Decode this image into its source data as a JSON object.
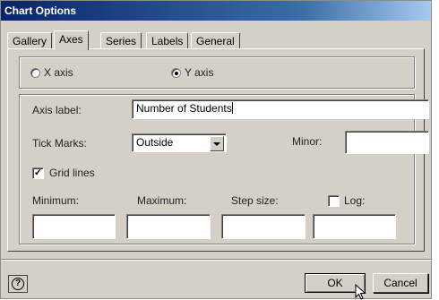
{
  "window": {
    "title": "Chart Options"
  },
  "tabs": [
    {
      "label": "Gallery"
    },
    {
      "label": "Axes"
    },
    {
      "label": "Series"
    },
    {
      "label": "Labels"
    },
    {
      "label": "General"
    }
  ],
  "axis_select": {
    "x_label": "X axis",
    "y_label": "Y axis",
    "selected": "Y axis"
  },
  "axis_label": {
    "label": "Axis label:",
    "value": "Number of Students"
  },
  "tick_marks": {
    "label": "Tick Marks:",
    "value": "Outside",
    "minor_label": "Minor:",
    "minor_value": ""
  },
  "grid_lines": {
    "label": "Grid lines",
    "checked": true
  },
  "range": {
    "minimum_label": "Minimum:",
    "maximum_label": "Maximum:",
    "step_label": "Step size:",
    "log_label": "Log:",
    "log_checked": false,
    "minimum_value": "",
    "maximum_value": "",
    "step_value": "",
    "log_value": ""
  },
  "buttons": {
    "ok": "OK",
    "cancel": "Cancel",
    "help": "?"
  }
}
